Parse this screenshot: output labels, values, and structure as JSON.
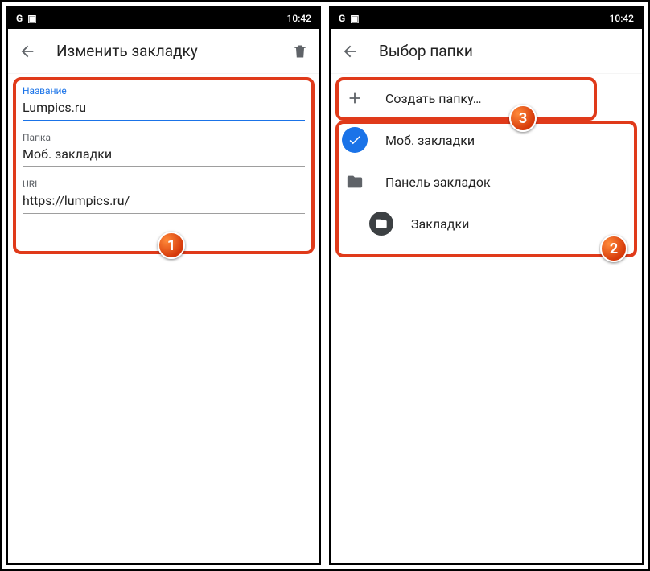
{
  "status": {
    "time": "10:42",
    "g": "G",
    "box": "▣"
  },
  "left": {
    "title": "Изменить закладку",
    "fields": {
      "name_label": "Название",
      "name_value": "Lumpics.ru",
      "folder_label": "Папка",
      "folder_value": "Моб. закладки",
      "url_label": "URL",
      "url_value": "https://lumpics.ru/"
    }
  },
  "right": {
    "title": "Выбор папки",
    "items": {
      "create": "Создать папку…",
      "mobile": "Моб. закладки",
      "bar": "Панель закладок",
      "bookmarks": "Закладки"
    }
  },
  "badges": {
    "b1": "1",
    "b2": "2",
    "b3": "3"
  }
}
